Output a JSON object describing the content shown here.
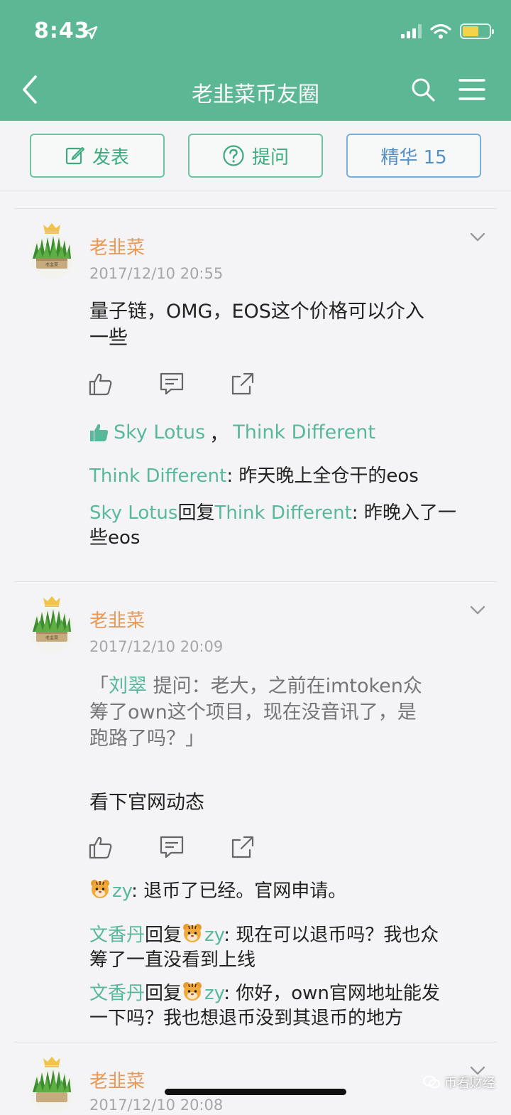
{
  "status_bar": {
    "time": "8:43"
  },
  "nav": {
    "title": "老韭菜币友圈"
  },
  "toolbar": {
    "post_label": "发表",
    "ask_label": "提问",
    "featured_label": "精华 15"
  },
  "posts": [
    {
      "author": "老韭菜",
      "avatar_caption": "老韭菜",
      "date": "2017/12/10 20:55",
      "body": [
        "量子链，OMG，EOS这个价格可以介入",
        "一些"
      ],
      "likes": [
        "Sky Lotus",
        "，",
        "Think Different"
      ],
      "comments": [
        {
          "user": "Think Different",
          "sep": ": ",
          "text": "昨天晚上全仓干的eos"
        },
        {
          "user": "Sky Lotus",
          "reply_word": "回复",
          "reply_to": "Think Different",
          "sep": ": ",
          "text": [
            "昨晚入了一",
            "些eos"
          ]
        }
      ]
    },
    {
      "author": "老韭菜",
      "avatar_caption": "老韭菜",
      "date": "2017/12/10 20:09",
      "quote": {
        "open": "「",
        "user": "刘翠",
        "text_line1": " 提问：老大，之前在imtoken众",
        "text_line2": "筹了own这个项目，现在没音讯了，是",
        "text_line3": "跑路了吗？」"
      },
      "body": "看下官网动态",
      "comments": [
        {
          "user": "zy",
          "sep": ": ",
          "text": "退币了已经。官网申请。"
        },
        {
          "user": "文香丹",
          "reply_word": "回复",
          "reply_to": "zy",
          "sep": ": ",
          "text": [
            "现在可以退币吗？我也众",
            "筹了一直没看到上线"
          ]
        },
        {
          "user": "文香丹",
          "reply_word": "回复",
          "reply_to": "zy",
          "sep": ": ",
          "text": [
            "你好，own官网地址能发",
            "一下吗？我也想退币没到其退币的地方"
          ]
        }
      ]
    },
    {
      "author": "老韭菜",
      "date": "2017/12/10 20:08"
    }
  ],
  "watermark": "币看财经",
  "icons": [
    "back-icon",
    "search-icon",
    "menu-icon",
    "edit-icon",
    "question-icon",
    "like-icon",
    "comment-icon",
    "share-icon",
    "chevron-down-icon",
    "crown-icon",
    "tiger-emoji-icon"
  ],
  "colors": {
    "header": "#5cb894",
    "accent": "#5ab89a",
    "author": "#e79a59",
    "featured": "#5590c4"
  }
}
